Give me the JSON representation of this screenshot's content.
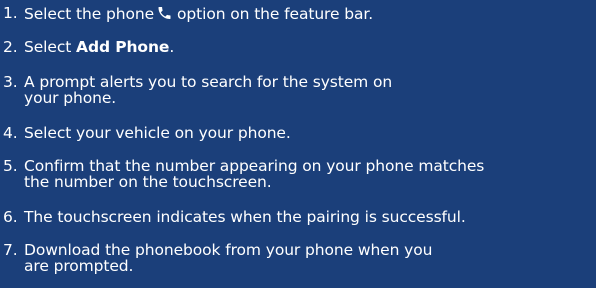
{
  "steps": [
    {
      "number": "1.",
      "before_icon": "Select the phone",
      "icon": "phone-handset-icon",
      "after_icon": "option on the feature bar."
    },
    {
      "number": "2.",
      "prefix": "Select ",
      "bold": "Add Phone",
      "suffix": "."
    },
    {
      "number": "3.",
      "line1": "A prompt alerts you to search for the system on",
      "line2": "your phone."
    },
    {
      "number": "4.",
      "line1": "Select your vehicle on your phone."
    },
    {
      "number": "5.",
      "line1": "Confirm that the number appearing on your phone matches",
      "line2": "the number on the touchscreen."
    },
    {
      "number": "6.",
      "line1": "The touchscreen indicates when the pairing is successful."
    },
    {
      "number": "7.",
      "line1": "Download the phonebook from your phone when you",
      "line2": "are prompted."
    }
  ],
  "colors": {
    "background": "#1b3f7a",
    "text": "#ffffff"
  }
}
